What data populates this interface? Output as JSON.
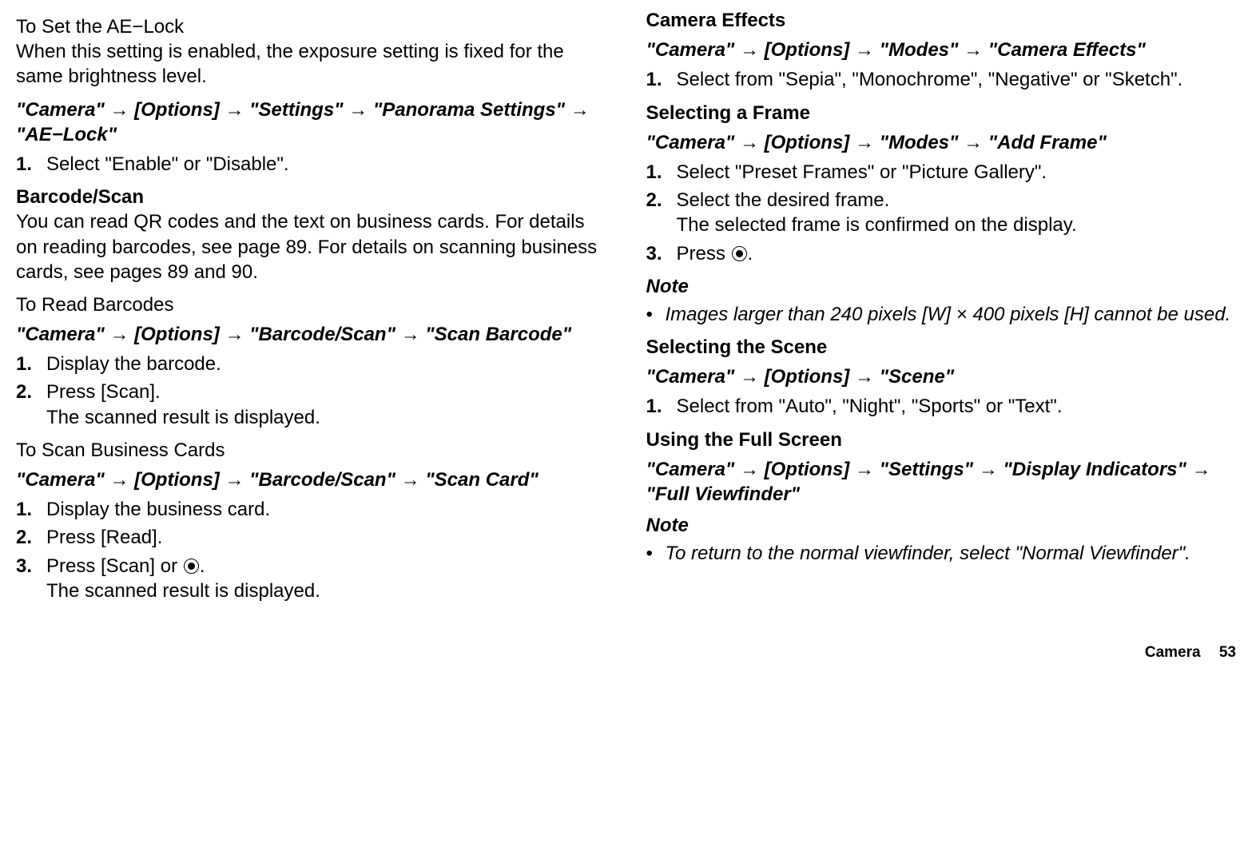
{
  "left": {
    "ae_lock": {
      "heading": "To Set the AE−Lock",
      "desc": "When this setting is enabled, the exposure setting is fixed for the same brightness level.",
      "path": "\"Camera\" → [Options] → \"Settings\" → \"Panorama Settings\" → \"AE−Lock\"",
      "step1": "Select \"Enable\" or \"Disable\"."
    },
    "barcode_scan": {
      "heading": "Barcode/Scan",
      "desc": "You can read QR codes and the text on business cards. For details on reading barcodes, see page 89. For details on scanning business cards, see pages 89 and 90."
    },
    "read_barcodes": {
      "heading": "To Read Barcodes",
      "path": "\"Camera\" → [Options] → \"Barcode/Scan\" → \"Scan Barcode\"",
      "step1": "Display the barcode.",
      "step2a": "Press [Scan].",
      "step2b": "The scanned result is displayed."
    },
    "scan_cards": {
      "heading": "To Scan Business Cards",
      "path": "\"Camera\" → [Options] → \"Barcode/Scan\" → \"Scan Card\"",
      "step1": "Display the business card.",
      "step2": "Press [Read].",
      "step3a": "Press [Scan] or ",
      "step3b": ".",
      "step3sub": "The scanned result is displayed."
    }
  },
  "right": {
    "camera_effects": {
      "heading": "Camera Effects",
      "path": "\"Camera\" → [Options] → \"Modes\" → \"Camera Effects\"",
      "step1": "Select from \"Sepia\", \"Monochrome\", \"Negative\" or \"Sketch\"."
    },
    "select_frame": {
      "heading": "Selecting a Frame",
      "path": "\"Camera\" → [Options] → \"Modes\" → \"Add Frame\"",
      "step1": "Select \"Preset Frames\" or \"Picture Gallery\".",
      "step2a": "Select the desired frame.",
      "step2b": "The selected frame is confirmed on the display.",
      "step3a": "Press ",
      "step3b": "."
    },
    "note1": {
      "label": "Note",
      "text": "Images larger than 240 pixels [W] × 400 pixels [H] cannot be used."
    },
    "select_scene": {
      "heading": "Selecting the Scene",
      "path": "\"Camera\" → [Options] → \"Scene\"",
      "step1": "Select from \"Auto\", \"Night\", \"Sports\" or \"Text\"."
    },
    "full_screen": {
      "heading": "Using the Full Screen",
      "path": "\"Camera\" → [Options] → \"Settings\" → \"Display Indicators\" → \"Full Viewfinder\""
    },
    "note2": {
      "label": "Note",
      "text": "To return to the normal viewfinder, select \"Normal Viewfinder\"."
    }
  },
  "footer": {
    "section": "Camera",
    "page": "53"
  },
  "numbers": {
    "n1": "1.",
    "n2": "2.",
    "n3": "3."
  },
  "bullet": "•"
}
